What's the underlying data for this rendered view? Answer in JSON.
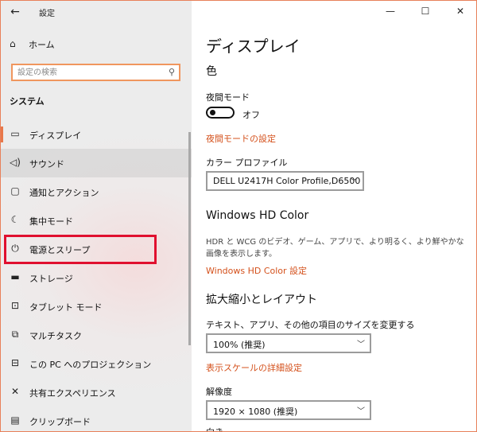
{
  "window": {
    "title": "設定",
    "controls": {
      "minimize": "—",
      "maximize": "☐",
      "close": "✕"
    }
  },
  "sidebar": {
    "back_icon": "←",
    "home": {
      "icon": "⌂",
      "label": "ホーム"
    },
    "search": {
      "placeholder": "設定の検索",
      "icon": "⚲"
    },
    "section_label": "システム",
    "items": [
      {
        "icon": "▭",
        "label": "ディスプレイ",
        "state": "active"
      },
      {
        "icon": "◁)",
        "label": "サウンド",
        "state": "hover"
      },
      {
        "icon": "▢",
        "label": "通知とアクション"
      },
      {
        "icon": "☾",
        "label": "集中モード"
      },
      {
        "icon": "⏻",
        "label": "電源とスリープ",
        "state": "highlighted"
      },
      {
        "icon": "▬",
        "label": "ストレージ"
      },
      {
        "icon": "⊡",
        "label": "タブレット モード"
      },
      {
        "icon": "⧉",
        "label": "マルチタスク"
      },
      {
        "icon": "⊟",
        "label": "この PC へのプロジェクション"
      },
      {
        "icon": "✕",
        "label": "共有エクスペリエンス"
      },
      {
        "icon": "▤",
        "label": "クリップボード"
      }
    ]
  },
  "content": {
    "page_title": "ディスプレイ",
    "color_heading": "色",
    "night_mode": {
      "label": "夜間モード",
      "toggle_state": "オフ",
      "settings_link": "夜間モードの設定"
    },
    "color_profile": {
      "label": "カラー プロファイル",
      "value": "DELL U2417H Color Profile,D6500"
    },
    "hd_color": {
      "heading": "Windows HD Color",
      "description": "HDR と WCG のビデオ、ゲーム、アプリで、より明るく、より鮮やかな画像を表示します。",
      "link": "Windows HD Color 設定"
    },
    "scale_layout": {
      "heading": "拡大縮小とレイアウト",
      "scale_label": "テキスト、アプリ、その他の項目のサイズを変更する",
      "scale_value": "100% (推奨)",
      "advanced_link": "表示スケールの詳細設定",
      "resolution_label": "解像度",
      "resolution_value": "1920 × 1080 (推奨)",
      "orientation_label": "向き"
    }
  },
  "colors": {
    "accent": "#d4511c",
    "highlight_box": "#e0102f",
    "active_indicator": "#e8784a"
  }
}
